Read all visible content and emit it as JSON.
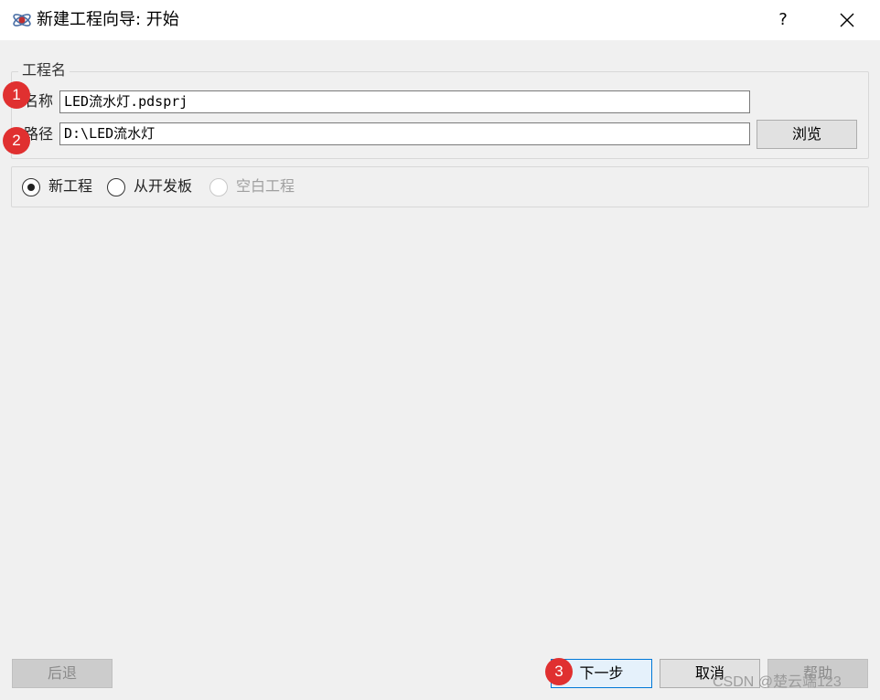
{
  "window": {
    "title": "新建工程向导: 开始",
    "help_label": "?",
    "close_icon": "close-icon",
    "app_icon": "atom-icon"
  },
  "project_group": {
    "label": "工程名",
    "name_label": "名称",
    "name_value": "LED流水灯.pdsprj",
    "path_label": "路径",
    "path_value": "D:\\LED流水灯",
    "browse_label": "浏览"
  },
  "project_type": {
    "options": [
      {
        "label": "新工程",
        "selected": true,
        "enabled": true
      },
      {
        "label": "从开发板",
        "selected": false,
        "enabled": true
      },
      {
        "label": "空白工程",
        "selected": false,
        "enabled": false
      }
    ]
  },
  "annotations": [
    "1",
    "2",
    "3"
  ],
  "footer": {
    "back_label": "后退",
    "next_label": "下一步",
    "cancel_label": "取消",
    "help_label": "帮助"
  },
  "watermark": "CSDN @楚云端123",
  "colors": {
    "accent": "#0078d7",
    "marker": "#e03030"
  }
}
